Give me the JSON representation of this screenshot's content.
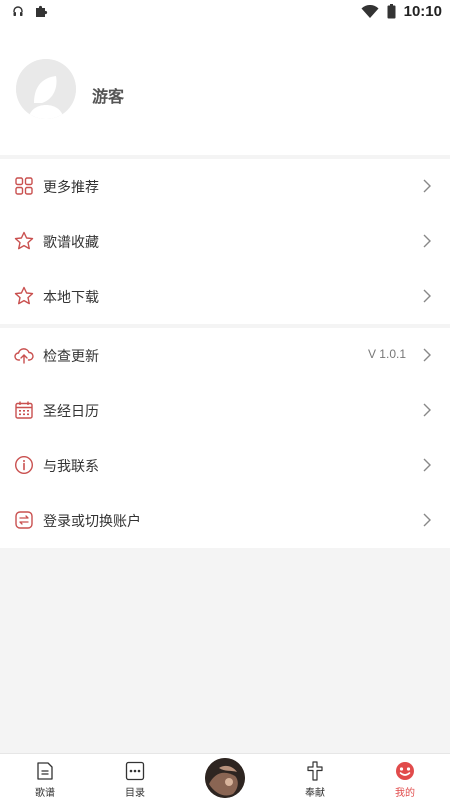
{
  "status_bar": {
    "time": "10:10",
    "icons": [
      "headphones-icon",
      "puzzle-icon",
      "wifi-icon",
      "battery-icon"
    ]
  },
  "profile": {
    "username": "游客",
    "avatar_icon": "avatar-placeholder-icon"
  },
  "menu_group_1": [
    {
      "label": "更多推荐",
      "icon": "grid-icon"
    },
    {
      "label": "歌谱收藏",
      "icon": "star-icon"
    },
    {
      "label": "本地下载",
      "icon": "star-icon"
    }
  ],
  "menu_group_2": [
    {
      "label": "检查更新",
      "icon": "cloud-upload-icon",
      "value": "V 1.0.1"
    },
    {
      "label": "圣经日历",
      "icon": "calendar-icon"
    },
    {
      "label": "与我联系",
      "icon": "info-icon"
    },
    {
      "label": "登录或切换账户",
      "icon": "switch-icon"
    }
  ],
  "tabbar": [
    {
      "label": "歌谱",
      "icon": "document-icon"
    },
    {
      "label": "目录",
      "icon": "more-dots-icon"
    },
    {
      "label": "",
      "icon": "music-disc-icon"
    },
    {
      "label": "奉献",
      "icon": "cross-icon"
    },
    {
      "label": "我的",
      "icon": "profile-face-icon",
      "active": true
    }
  ],
  "colors": {
    "accent": "#e14b4b",
    "icon_red": "#c9504f",
    "background": "#f4f4f4"
  }
}
